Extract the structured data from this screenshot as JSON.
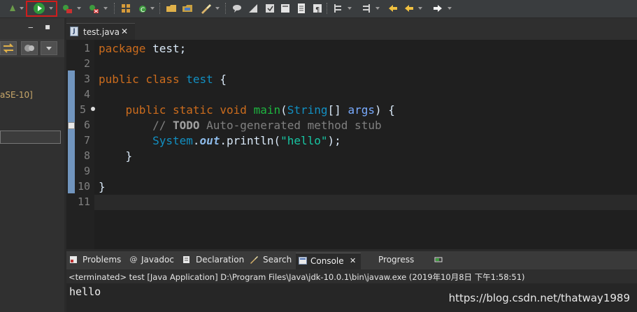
{
  "editor": {
    "tab_label": "test.java",
    "tab_close": "✕",
    "file_icon": "J",
    "line_numbers": [
      "1",
      "2",
      "3",
      "4",
      "5",
      "6",
      "7",
      "8",
      "9",
      "10",
      "11"
    ],
    "code": {
      "l1_kw": "package",
      "l1_rest": " test;",
      "l3_kw": "public class",
      "l3_name": "test",
      "l3_rest": " {",
      "l5_kw": "    public static void",
      "l5_fn": "main",
      "l5_open": "(",
      "l5_type": "String",
      "l5_brackets": "[] ",
      "l5_arg": "args",
      "l5_close": ") {",
      "l6_comment_start": "        // ",
      "l6_todo": "TODO",
      "l6_comment_rest": " Auto-generated method stub",
      "l7_indent": "        ",
      "l7_system": "System",
      "l7_dot1": ".",
      "l7_out": "out",
      "l7_dot2": ".",
      "l7_println": "println(",
      "l7_str": "\"hello\"",
      "l7_end": ");",
      "l8": "    }",
      "l10": "}"
    }
  },
  "left_panel": {
    "minimize": "‒",
    "maximize": "▪",
    "tree_text": "aSE-10]"
  },
  "bottom_tabs": {
    "problems": "Problems",
    "javadoc": "Javadoc",
    "declaration": "Declaration",
    "search": "Search",
    "console": "Console",
    "console_close": "✕",
    "progress": "Progress"
  },
  "console": {
    "status": "<terminated> test [Java Application] D:\\Program Files\\Java\\jdk-10.0.1\\bin\\javaw.exe (2019年10月8日 下午1:58:51)",
    "output": "hello"
  },
  "watermark": "https://blog.csdn.net/thatway1989",
  "colors": {
    "keyword": "#cc6c1d",
    "type": "#1290c3",
    "method": "#1eb540",
    "string": "#17c6a3",
    "run_highlight": "#d01c1c"
  }
}
